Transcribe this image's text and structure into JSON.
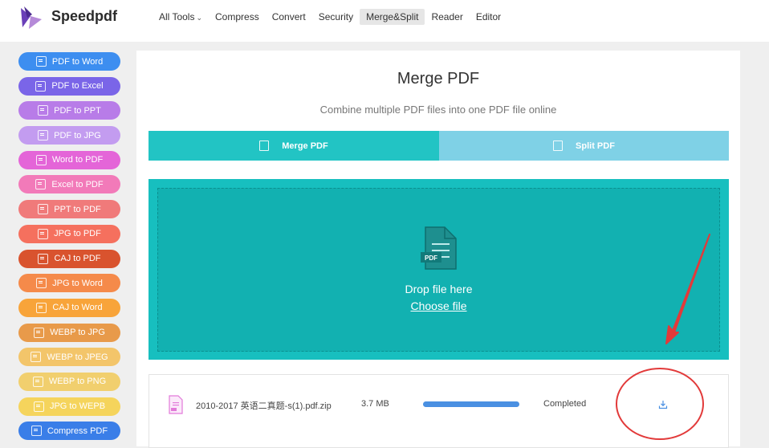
{
  "header": {
    "brand": "Speedpdf",
    "nav": [
      {
        "label": "All Tools",
        "has_chevron": true,
        "active": false
      },
      {
        "label": "Compress",
        "active": false
      },
      {
        "label": "Convert",
        "active": false
      },
      {
        "label": "Security",
        "active": false
      },
      {
        "label": "Merge&Split",
        "active": true
      },
      {
        "label": "Reader",
        "active": false
      },
      {
        "label": "Editor",
        "active": false
      }
    ]
  },
  "sidebar": {
    "items": [
      {
        "label": "PDF to Word",
        "color": "#3d8ef0"
      },
      {
        "label": "PDF to Excel",
        "color": "#7a65e8"
      },
      {
        "label": "PDF to PPT",
        "color": "#b87ce8"
      },
      {
        "label": "PDF to JPG",
        "color": "#c39cf0"
      },
      {
        "label": "Word to PDF",
        "color": "#e465d8"
      },
      {
        "label": "Excel to PDF",
        "color": "#f27ab9"
      },
      {
        "label": "PPT to PDF",
        "color": "#f07a7a"
      },
      {
        "label": "JPG to PDF",
        "color": "#f5705e"
      },
      {
        "label": "CAJ to PDF",
        "color": "#d9532e"
      },
      {
        "label": "JPG to Word",
        "color": "#f58a4a"
      },
      {
        "label": "CAJ to Word",
        "color": "#f8a43a"
      },
      {
        "label": "WEBP to JPG",
        "color": "#e89a4a"
      },
      {
        "label": "WEBP to JPEG",
        "color": "#f3c56a"
      },
      {
        "label": "WEBP to PNG",
        "color": "#f1cf6e"
      },
      {
        "label": "JPG to WEPB",
        "color": "#f5d45c"
      },
      {
        "label": "Compress PDF",
        "color": "#3a7ee8"
      }
    ]
  },
  "main": {
    "title": "Merge PDF",
    "subtitle": "Combine multiple PDF files into one PDF file online",
    "tabs": [
      {
        "label": "Merge PDF",
        "active": true
      },
      {
        "label": "Split PDF",
        "active": false
      }
    ],
    "dropzone": {
      "icon": "pdf-file-icon",
      "icon_badge": "PDF",
      "text": "Drop file here",
      "link": "Choose file"
    },
    "file": {
      "name": "2010-2017 英语二真题-s(1).pdf.zip",
      "size": "3.7 MB",
      "progress": 1.0,
      "status": "Completed",
      "action_icon": "download-icon"
    }
  }
}
